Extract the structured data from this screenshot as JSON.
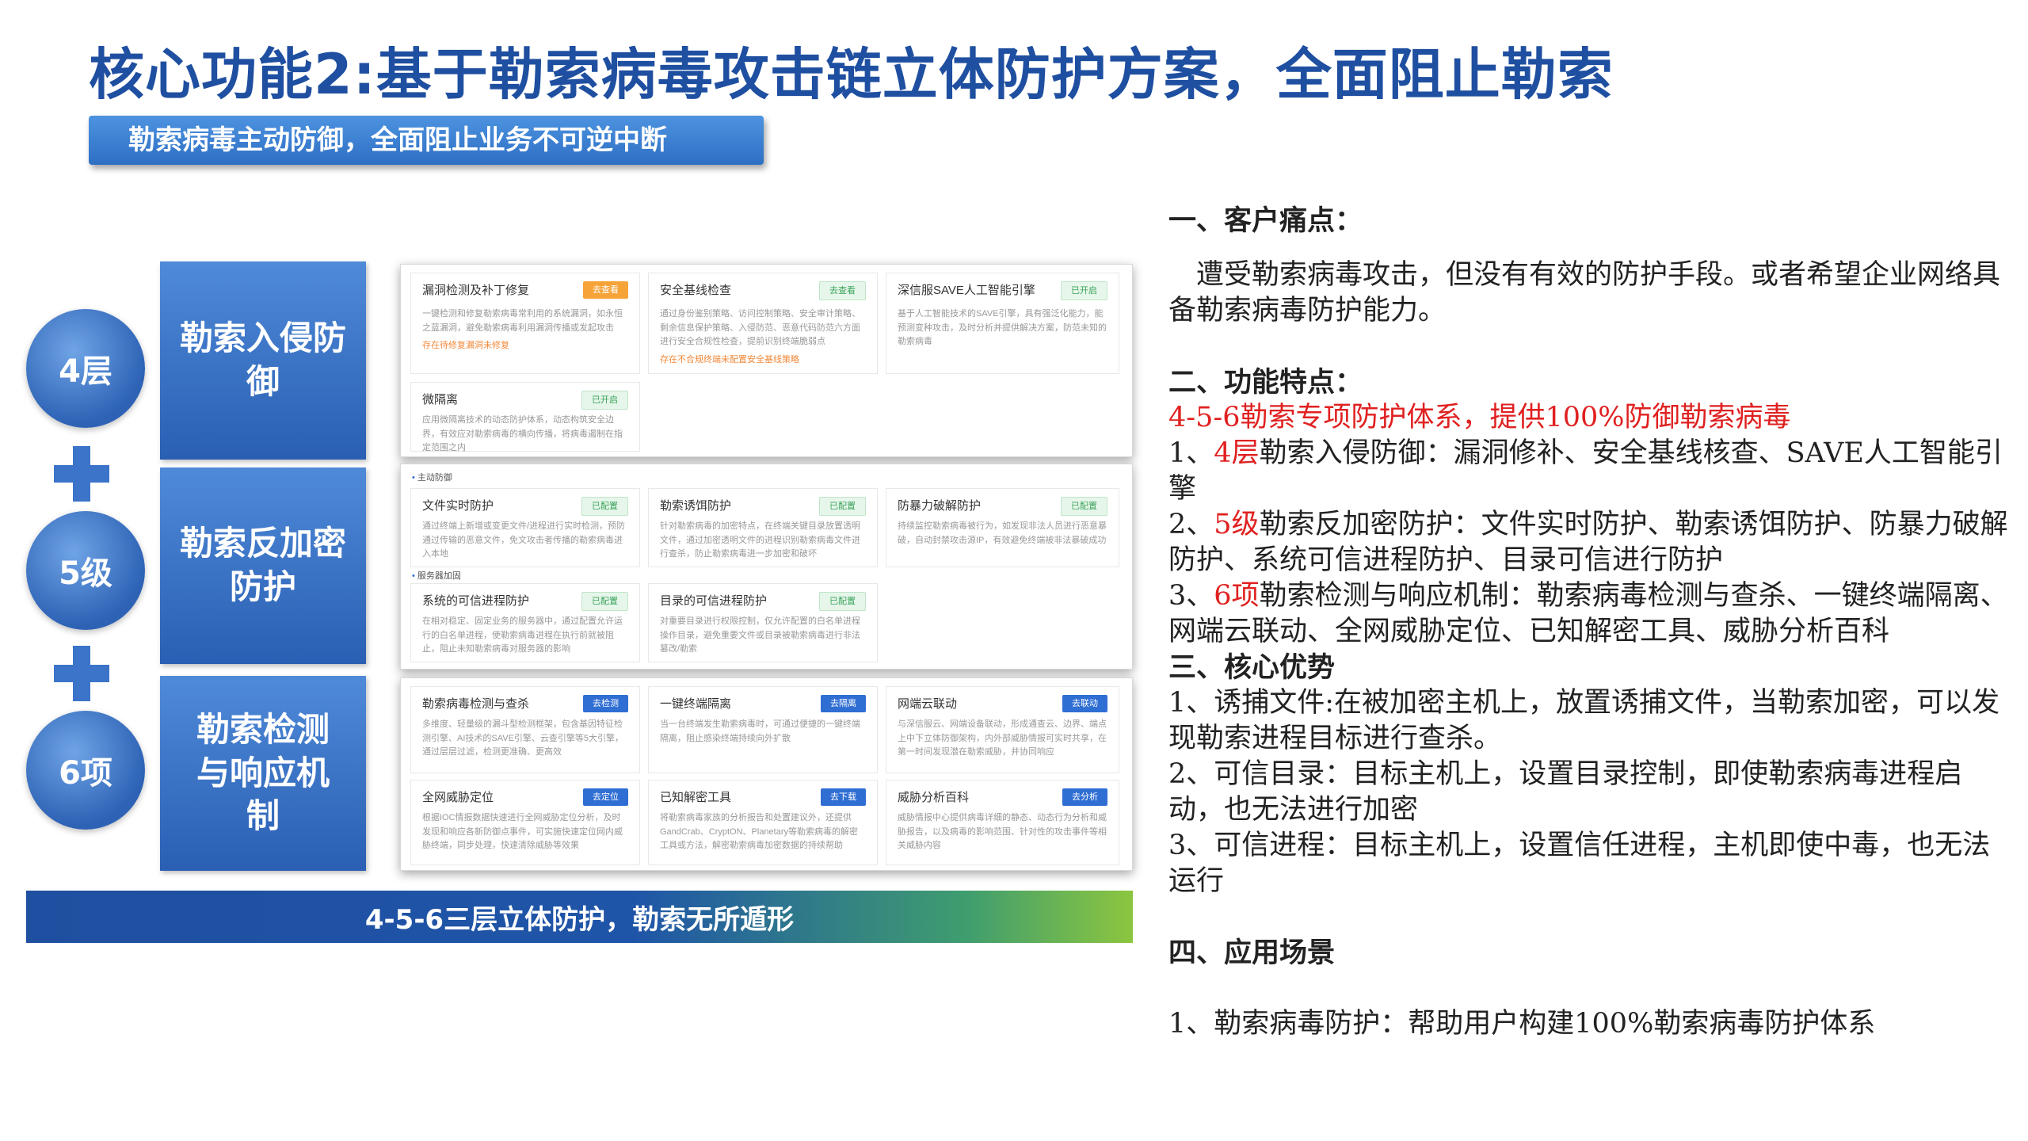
{
  "title": "核心功能2:基于勒索病毒攻击链立体防护方案，全面阻止勒索",
  "subtitle": "勒索病毒主动防御，全面阻止业务不可逆中断",
  "left": {
    "levels": [
      {
        "circle": "4层",
        "block": "勒索入侵防御"
      },
      {
        "circle": "5级",
        "block": "勒索反加密防护"
      },
      {
        "circle": "6项",
        "block": "勒索检测与响应机制"
      }
    ],
    "bottom_banner": "4-5-6三层立体防护，勒索无所遁形"
  },
  "panel1": {
    "cards": [
      {
        "title": "漏洞检测及补丁修复",
        "tag": "去查看",
        "desc": "一键检测和修复勒索病毒常利用的系统漏洞，如永恒之蓝漏洞，避免勒索病毒利用漏洞传播或发起攻击",
        "warn": "存在待修复漏洞未修复"
      },
      {
        "title": "安全基线检查",
        "tag": "去查看",
        "desc": "通过身份鉴别策略、访问控制策略、安全审计策略、剩余信息保护策略、入侵防范、恶意代码防范六方面进行安全合规性检查，提前识别终端脆弱点",
        "warn": "存在不合规终端未配置安全基线策略"
      },
      {
        "title": "深信服SAVE人工智能引擎",
        "tag": "已开启",
        "desc": "基于人工智能技术的SAVE引擎，具有强泛化能力，能预测变种攻击，及时分析并提供解决方案，防范未知的勒索病毒",
        "warn": ""
      },
      {
        "title": "微隔离",
        "tag": "已开启",
        "desc": "应用微隔离技术的动态防护体系，动态构筑安全边界，有效应对勒索病毒的横向传播，将病毒遏制在指定范围之内",
        "warn": ""
      }
    ]
  },
  "panel2": {
    "section1": "主动防御",
    "section2": "服务器加固",
    "cards": [
      {
        "title": "文件实时防护",
        "tag": "已配置",
        "desc": "通过终端上新增或变更文件/进程进行实时检测，预防通过传输的恶意文件，免文攻击者传播的勒索病毒进入本地"
      },
      {
        "title": "勒索诱饵防护",
        "tag": "已配置",
        "desc": "针对勒索病毒的加密特点，在终端关键目录放置透明文件，通过加密透明文件的进程识别勒索病毒文件进行查杀，防止勒索病毒进一步加密和破坏"
      },
      {
        "title": "防暴力破解防护",
        "tag": "已配置",
        "desc": "持续监控勒索病毒被行为，如发现非法人员进行恶意暴破，自动封禁攻击源IP，有效避免终端被非法暴破成功"
      },
      {
        "title": "系统的可信进程防护",
        "tag": "已配置",
        "desc": "在相对稳定、固定业务的服务器中，通过配置允许运行的白名单进程，使勒索病毒进程在执行前就被阻止，阻止未知勒索病毒对服务器的影响"
      },
      {
        "title": "目录的可信进程防护",
        "tag": "已配置",
        "desc": "对重要目录进行权限控制，仅允许配置的白名单进程操作目录，避免重要文件或目录被勒索病毒进行非法篡改/勒索"
      }
    ]
  },
  "panel3": {
    "cards": [
      {
        "title": "勒索病毒检测与查杀",
        "tag": "去检测",
        "desc": "多维度、轻量级的漏斗型检测框架，包含基因特征检测引擎、AI技术的SAVE引擎、云查引擎等5大引擎，通过层层过滤，检测更准确、更高效"
      },
      {
        "title": "一键终端隔离",
        "tag": "去隔离",
        "desc": "当一台终端发生勒索病毒时，可通过便捷的一键终端隔离，阻止感染终端持续向外扩散"
      },
      {
        "title": "网端云联动",
        "tag": "去联动",
        "desc": "与深信服云、网端设备联动，形成通查云、边界、端点上中下立体防御架构，内外部威胁情报可实时共享，在第一时间发现潜在勒索威胁，并协同响应"
      },
      {
        "title": "全网威胁定位",
        "tag": "去定位",
        "desc": "根据IOC情报数据快速进行全网威胁定位分析，及时发现和响应各新防御点事件，可实施快速定位网内威胁终端，同步处理，快速清除威胁等效果"
      },
      {
        "title": "已知解密工具",
        "tag": "去下载",
        "desc": "将勒索病毒家族的分析报告和处置建议外，还提供GandCrab、CryptON、Planetary等勒索病毒的解密工具或方法，解密勒索病毒加密数据的持续帮助"
      },
      {
        "title": "威胁分析百科",
        "tag": "去分析",
        "desc": "威胁情报中心提供病毒详细的静态、动态行为分析和威胁报告，以及病毒的影响范围、针对性的攻击事件等相关威胁内容"
      }
    ]
  },
  "right": {
    "pain_heading": "一、客户痛点：",
    "pain_text": "　遭受勒索病毒攻击，但没有有效的防护手段。或者希望企业网络具备勒索病毒防护能力。",
    "feat_heading": "二、功能特点：",
    "feat_red": "4-5-6勒索专项防护体系，提供100%防御勒索病毒",
    "feat1_pre": "1、",
    "feat1_red": "4层",
    "feat1_text": "勒索入侵防御：漏洞修补、安全基线核查、SAVE人工智能引擎",
    "feat2_pre": "2、",
    "feat2_red": "5级",
    "feat2_text": "勒索反加密防护：文件实时防护、勒索诱饵防护、防暴力破解防护、系统可信进程防护、目录可信进行防护",
    "feat3_pre": "3、",
    "feat3_red": "6项",
    "feat3_text": "勒索检测与响应机制：勒索病毒检测与查杀、一键终端隔离、网端云联动、全网威胁定位、已知解密工具、威胁分析百科",
    "adv_heading": "三、核心优势",
    "adv1": " 1、诱捕文件:在被加密主机上，放置诱捕文件，当勒索加密，可以发现勒索进程目标进行查杀。",
    "adv2": " 2、可信目录：目标主机上，设置目录控制，即使勒索病毒进程启动，也无法进行加密",
    "adv3": " 3、可信进程：目标主机上，设置信任进程，主机即使中毒，也无法运行",
    "scene_heading": "四、应用场景",
    "scene1": " 1、勒索病毒防护：帮助用户构建100%勒索病毒防护体系"
  }
}
